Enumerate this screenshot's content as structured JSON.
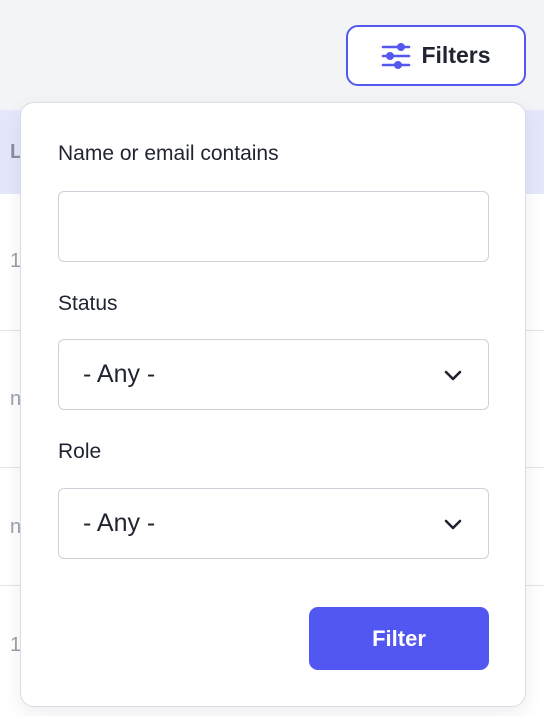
{
  "background_table": {
    "header_text": "L",
    "row_snippets": [
      "1",
      "n",
      "n",
      "1"
    ]
  },
  "toolbar": {
    "filters_icon": "sliders-icon",
    "filters_label": "Filters",
    "accent_color": "#5558f0"
  },
  "filter_panel": {
    "name_field": {
      "label": "Name or email contains",
      "value": "",
      "placeholder": ""
    },
    "status_field": {
      "label": "Status",
      "selected": "- Any -",
      "icon": "chevron-down-icon"
    },
    "role_field": {
      "label": "Role",
      "selected": "- Any -",
      "icon": "chevron-down-icon"
    },
    "submit": {
      "label": "Filter",
      "color": "#5257f2"
    }
  }
}
